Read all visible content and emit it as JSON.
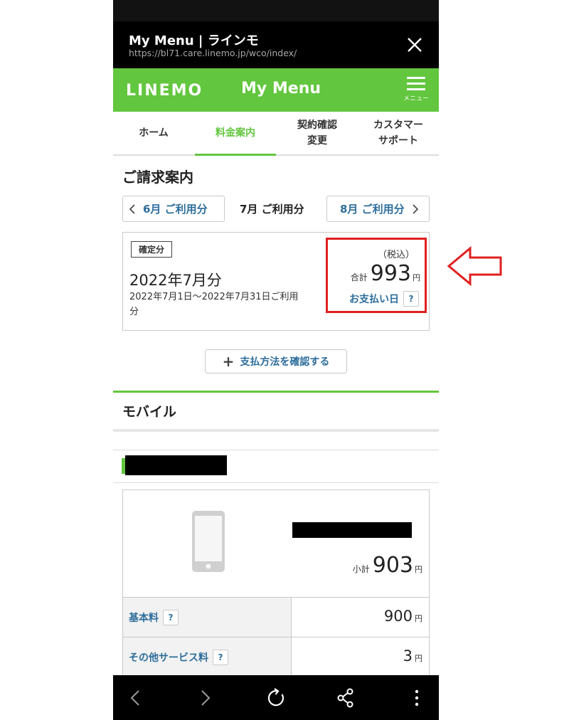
{
  "browser": {
    "title": "My Menu | ラインモ",
    "url": "https://bl71.care.linemo.jp/wco/index/"
  },
  "app_header": {
    "logo": "LINEMO",
    "title": "My Menu",
    "menu_label": "メニュー",
    "brand_color": "#62c63e"
  },
  "tabs": [
    {
      "label": "ホーム"
    },
    {
      "label": "料金案内",
      "active": true
    },
    {
      "label_line1": "契約確認",
      "label_line2": "変更"
    },
    {
      "label_line1": "カスタマー",
      "label_line2": "サポート"
    }
  ],
  "billing": {
    "section_title": "ご請求案内",
    "prev_month": "6月 ご利用分",
    "current_month": "7月 ご利用分",
    "next_month": "8月 ご利用分",
    "status_badge": "確定分",
    "bill_month": "2022年7月分",
    "period": "2022年7月1日〜2022年7月31日ご利用分",
    "tax_label": "（税込）",
    "total_label": "合計",
    "total_value": "993",
    "currency": "円",
    "payment_date_label": "お支払い日",
    "help_label": "?",
    "highlight_color": "#e02020"
  },
  "payment_button": {
    "label": "支払方法を確認する"
  },
  "mobile": {
    "section_title": "モバイル",
    "subtotal_label": "小計",
    "subtotal_value": "903",
    "currency": "円",
    "fees": [
      {
        "label": "基本料",
        "help": "?",
        "value": "900",
        "currency": "円"
      },
      {
        "label": "その他サービス料",
        "help": "?",
        "value": "3",
        "currency": "円"
      }
    ]
  },
  "icons": {
    "close": "close-icon",
    "menu": "hamburger-menu-icon",
    "chevron_left": "chevron-left-icon",
    "chevron_right": "chevron-right-icon",
    "plus": "plus-icon",
    "phone": "smartphone-icon",
    "arrow": "left-arrow-annotation-icon",
    "back": "back-icon",
    "forward": "forward-icon",
    "reload": "reload-icon",
    "share": "share-icon",
    "more": "more-vertical-icon"
  }
}
